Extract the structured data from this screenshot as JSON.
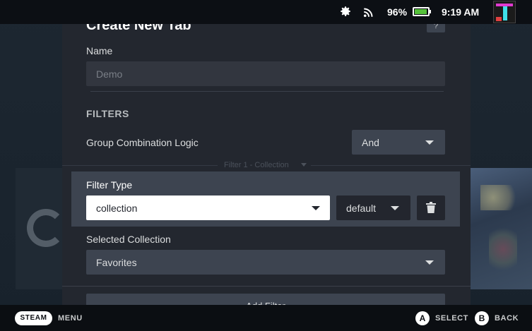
{
  "status": {
    "battery_percent": "96%",
    "battery_level": 0.96,
    "time": "9:19 AM",
    "icons": [
      "gear-icon",
      "wifi-icon",
      "battery-icon",
      "avatar"
    ]
  },
  "modal": {
    "title": "Create New Tab",
    "help_label": "?",
    "name_label": "Name",
    "name_placeholder": "Demo",
    "filters_heading": "FILTERS",
    "group_logic_label": "Group Combination Logic",
    "group_logic_value": "And",
    "filter_separator": "Filter 1 - Collection",
    "filter_type_label": "Filter Type",
    "filter_type_value": "collection",
    "filter_mode_value": "default",
    "selected_collection_label": "Selected Collection",
    "selected_collection_value": "Favorites",
    "add_filter_label": "Add Filter"
  },
  "hints": {
    "steam": "STEAM",
    "menu": "MENU",
    "a_button": "A",
    "select": "SELECT",
    "b_button": "B",
    "back": "BACK"
  },
  "colors": {
    "modal_bg": "#23272f",
    "control_bg": "#3d4450",
    "battery_green": "#56c23b"
  }
}
